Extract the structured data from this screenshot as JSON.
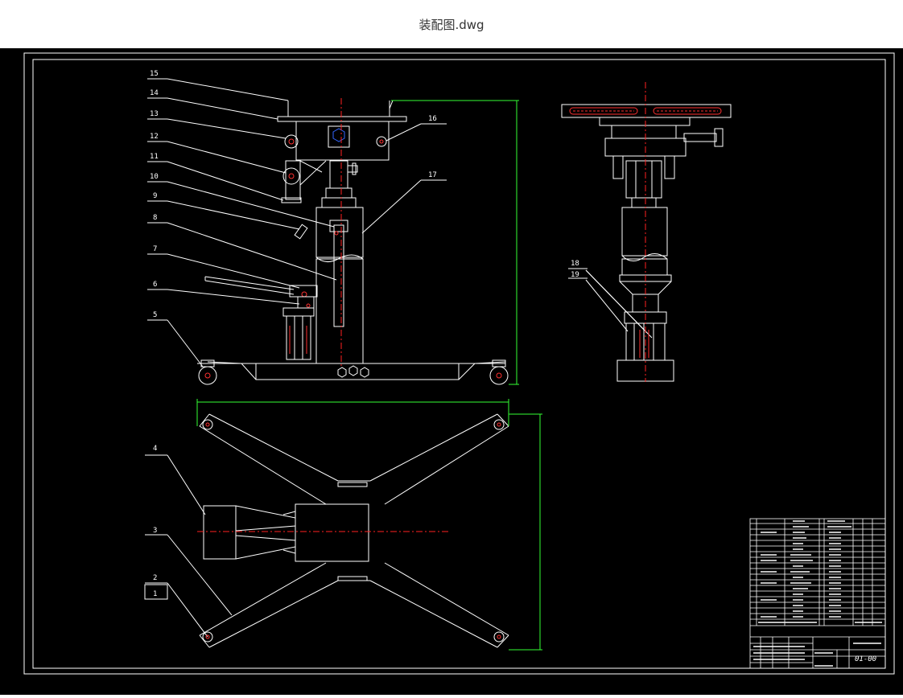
{
  "window": {
    "title": "装配图.dwg"
  },
  "colors": {
    "background": "#000000",
    "line": "#ffffff",
    "center_line": "#ff2020",
    "dimension": "#33ff33",
    "accent": "#ff3030"
  },
  "drawing": {
    "balloons": [
      "15",
      "14",
      "13",
      "12",
      "11",
      "10",
      "9",
      "8",
      "7",
      "6",
      "5",
      "4",
      "3",
      "2",
      "1",
      "16",
      "17",
      "18",
      "19"
    ],
    "title_block": {
      "drawing_no": "01-00"
    }
  }
}
